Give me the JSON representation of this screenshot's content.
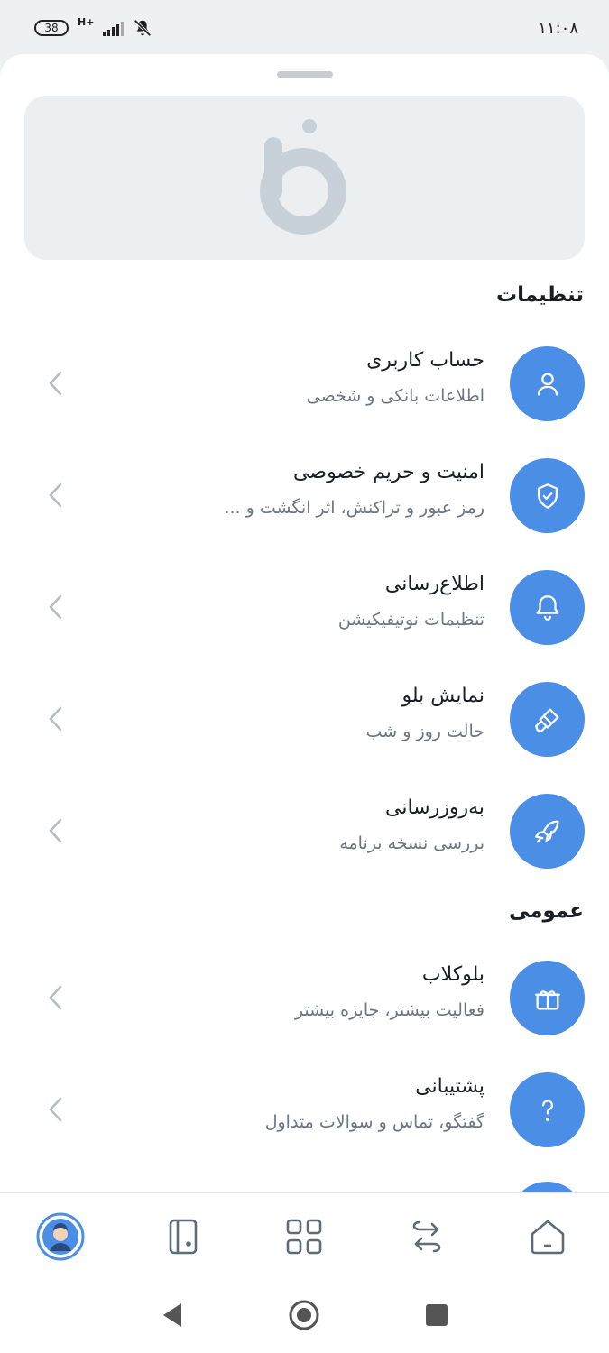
{
  "status": {
    "battery": "38",
    "network": "H+",
    "time": "۱۱:۰۸"
  },
  "banner": {
    "logo": "b-logo"
  },
  "sections": {
    "settings_title": "تنظیمات",
    "general_title": "عمومی"
  },
  "settings_items": [
    {
      "title": "حساب کاربری",
      "subtitle": "اطلاعات بانکی و شخصی",
      "icon": "user-icon"
    },
    {
      "title": "امنیت و حریم خصوصی",
      "subtitle": "رمز عبور و تراکنش، اثر انگشت و ...",
      "icon": "shield-check-icon"
    },
    {
      "title": "اطلاع‌رسانی",
      "subtitle": "تنظیمات نوتیفیکیشن",
      "icon": "bell-icon"
    },
    {
      "title": "نمایش بلو",
      "subtitle": "حالت روز و شب",
      "icon": "paint-brush-icon"
    },
    {
      "title": "به‌روزرسانی",
      "subtitle": "بررسی نسخه برنامه",
      "icon": "rocket-icon"
    }
  ],
  "general_items": [
    {
      "title": "بلوکلاب",
      "subtitle": "فعالیت بیشتر، جایزه بیشتر",
      "icon": "gift-icon"
    },
    {
      "title": "پشتیبانی",
      "subtitle": "گفتگو، تماس و سوالات متداول",
      "icon": "question-icon"
    }
  ],
  "bottom_nav": [
    "profile-avatar-icon",
    "card-icon",
    "services-grid-icon",
    "transfer-icon",
    "home-icon"
  ],
  "colors": {
    "accent": "#4b8ee6",
    "icon_gray": "#5e6b78",
    "logo_gray": "#c8d0d8"
  }
}
